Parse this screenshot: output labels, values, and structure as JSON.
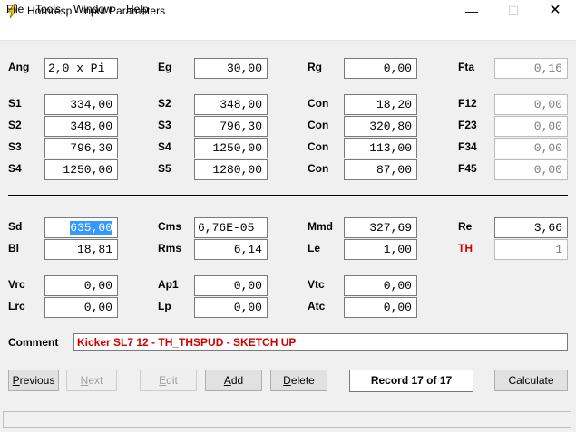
{
  "window": {
    "title": "Hornresp - Input Parameters",
    "minimize": "—",
    "maximize": "☐",
    "close": "✕"
  },
  "menu": {
    "file_u": "F",
    "file_rest": "ile",
    "tools_u": "T",
    "tools_rest": "ools",
    "window_u": "W",
    "window_rest": "indow",
    "help_u": "H",
    "help_rest": "elp"
  },
  "params": {
    "ang": {
      "label": "Ang",
      "value": "2,0 x Pi"
    },
    "eg": {
      "label": "Eg",
      "value": "30,00"
    },
    "rg": {
      "label": "Rg",
      "value": "0,00"
    },
    "fta": {
      "label": "Fta",
      "value": "0,16"
    },
    "s1": {
      "label": "S1",
      "value": "334,00"
    },
    "s2a": {
      "label": "S2",
      "value": "348,00"
    },
    "s3a": {
      "label": "S3",
      "value": "796,30"
    },
    "s4a": {
      "label": "S4",
      "value": "1250,00"
    },
    "s2b": {
      "label": "S2",
      "value": "348,00"
    },
    "s3b": {
      "label": "S3",
      "value": "796,30"
    },
    "s4b": {
      "label": "S4",
      "value": "1250,00"
    },
    "s5": {
      "label": "S5",
      "value": "1280,00"
    },
    "con1": {
      "label": "Con",
      "value": "18,20"
    },
    "con2": {
      "label": "Con",
      "value": "320,80"
    },
    "con3": {
      "label": "Con",
      "value": "113,00"
    },
    "con4": {
      "label": "Con",
      "value": "87,00"
    },
    "f12": {
      "label": "F12",
      "value": "0,00"
    },
    "f23": {
      "label": "F23",
      "value": "0,00"
    },
    "f34": {
      "label": "F34",
      "value": "0,00"
    },
    "f45": {
      "label": "F45",
      "value": "0,00"
    },
    "sd": {
      "label": "Sd",
      "value": "635,00"
    },
    "bl": {
      "label": "Bl",
      "value": "18,81"
    },
    "cms": {
      "label": "Cms",
      "value": "6,76E-05"
    },
    "rms": {
      "label": "Rms",
      "value": "6,14"
    },
    "mmd": {
      "label": "Mmd",
      "value": "327,69"
    },
    "le": {
      "label": "Le",
      "value": "1,00"
    },
    "re": {
      "label": "Re",
      "value": "3,66"
    },
    "th": {
      "label": "TH",
      "value": "1"
    },
    "vrc": {
      "label": "Vrc",
      "value": "0,00"
    },
    "lrc": {
      "label": "Lrc",
      "value": "0,00"
    },
    "ap1": {
      "label": "Ap1",
      "value": "0,00"
    },
    "lp": {
      "label": "Lp",
      "value": "0,00"
    },
    "vtc": {
      "label": "Vtc",
      "value": "0,00"
    },
    "atc": {
      "label": "Atc",
      "value": "0,00"
    }
  },
  "comment": {
    "label": "Comment",
    "value": "Kicker SL7 12 - TH_THSPUD - SKETCH UP"
  },
  "buttons": {
    "previous_u": "P",
    "previous_rest": "revious",
    "next_u": "N",
    "next_rest": "ext",
    "edit_u": "E",
    "edit_rest": "dit",
    "add_u": "A",
    "add_rest": "dd",
    "delete_u": "D",
    "delete_rest": "elete",
    "calculate": "Calculate"
  },
  "record": "Record 17 of 17",
  "colors": {
    "accent_red": "#d00000",
    "selection": "#3399ff"
  }
}
